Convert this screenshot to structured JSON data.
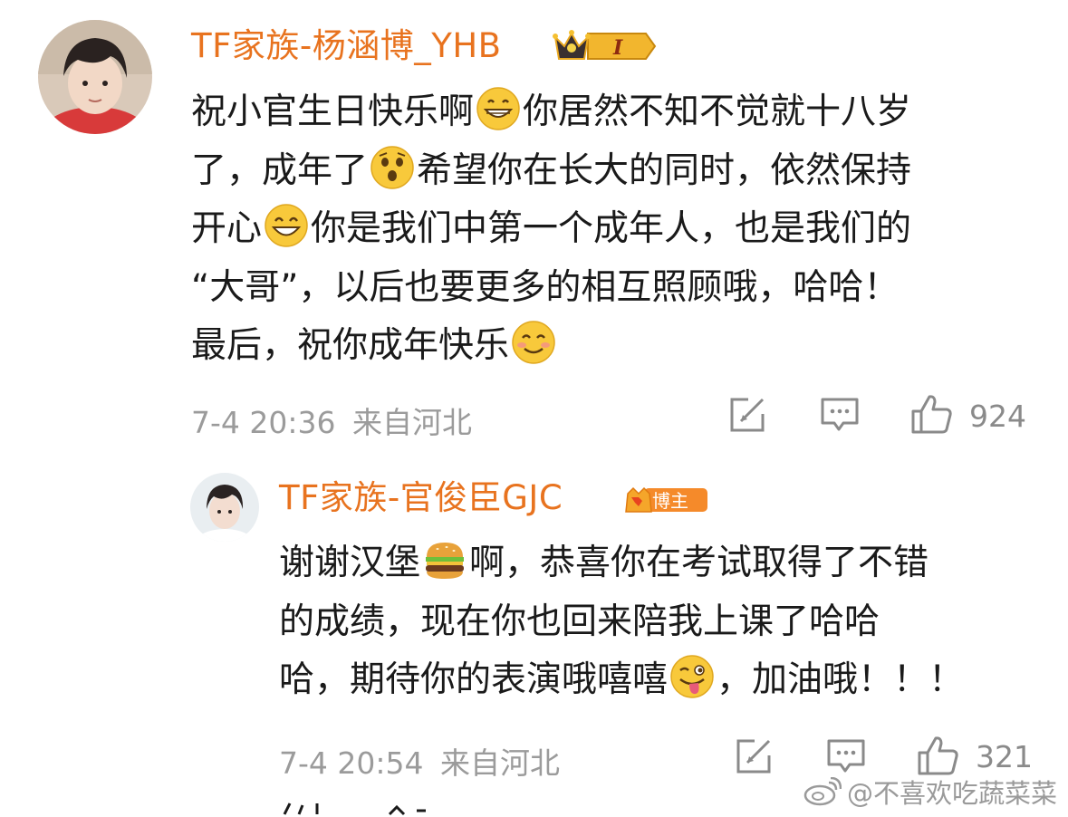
{
  "comment": {
    "author": "TF家族-杨涵博_YHB",
    "badge_level": "I",
    "lines": [
      [
        "祝小官生日快乐啊",
        "😁",
        "你居然不知不觉就十八岁"
      ],
      [
        "了，成年了",
        "😲",
        "希望你在长大的同时，依然保持"
      ],
      [
        "开心",
        "😄",
        "你是我们中第一个成年人，也是我们的"
      ],
      [
        "“大哥”，以后也要更多的相互照顾哦，哈哈！"
      ],
      [
        "最后，祝你成年快乐",
        "😊",
        ""
      ]
    ],
    "timestamp": "7-4 20:36",
    "location": "来自河北",
    "likes": "924"
  },
  "reply": {
    "author": "TF家族-官俊臣GJC",
    "badge_label": "博主",
    "lines": [
      [
        "谢谢汉堡",
        "🍔",
        "啊，恭喜你在考试取得了不错"
      ],
      [
        "的成绩，现在你也回来陪我上课了哈哈"
      ],
      [
        "哈，期待你的表演哦嘻嘻",
        "😜",
        "，加油哦！！！"
      ]
    ],
    "timestamp": "7-4 20:54",
    "location": "来自河北",
    "likes": "321"
  },
  "watermark": "@不喜欢吃蔬菜菜",
  "icons": {
    "share": "share-icon",
    "comment": "comment-icon",
    "like": "thumbs-up-icon"
  },
  "colors": {
    "username": "#e8731f",
    "meta": "#9b9b9b"
  }
}
